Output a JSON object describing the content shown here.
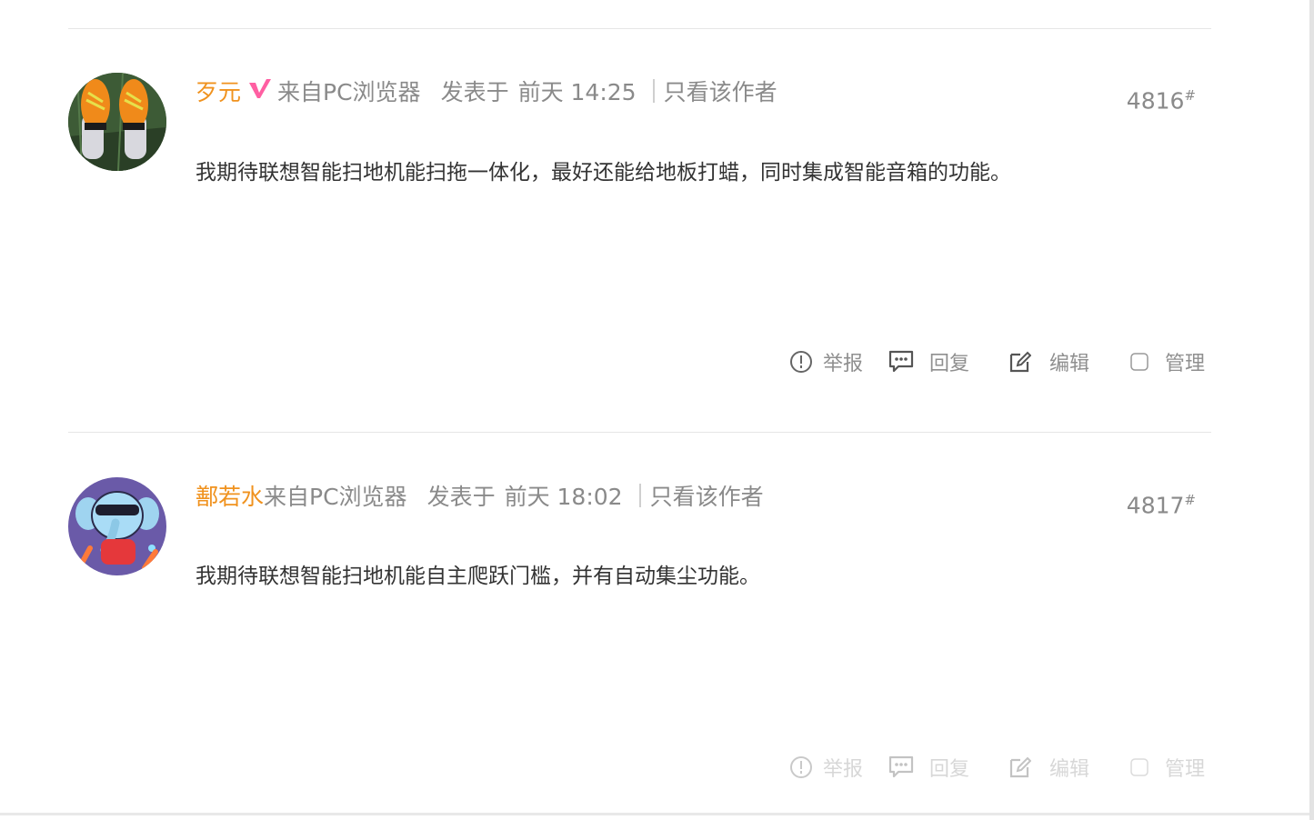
{
  "posts": [
    {
      "author": "歹元",
      "badge_icon": "v-badge-icon",
      "source": "来自PC浏览器",
      "posted_prefix": "发表于",
      "posted_time": "前天 14:25",
      "author_only": "只看该作者",
      "floor": "4816",
      "floor_mark": "#",
      "content": "我期待联想智能扫地机能扫拖一体化，最好还能给地板打蜡，同时集成智能音箱的功能。"
    },
    {
      "author": "鄯若水",
      "source": "来自PC浏览器",
      "posted_prefix": "发表于",
      "posted_time": "前天 18:02",
      "author_only": "只看该作者",
      "floor": "4817",
      "floor_mark": "#",
      "content": "我期待联想智能扫地机能自主爬跃门槛，并有自动集尘功能。"
    }
  ],
  "actions": {
    "report": "举报",
    "reply": "回复",
    "edit": "编辑",
    "manage": "管理"
  },
  "colors": {
    "author": "#f0921e",
    "meta": "#8a8a8a",
    "content": "#333333",
    "badge": "#ff5fa2"
  }
}
